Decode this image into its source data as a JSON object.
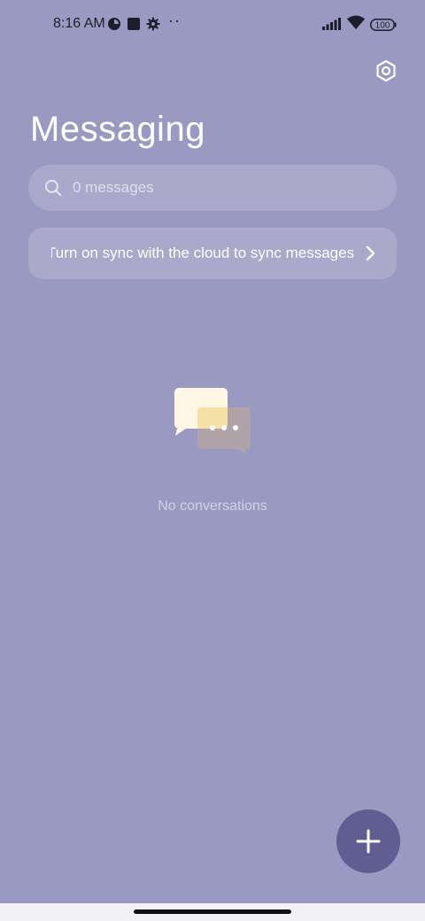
{
  "status_bar": {
    "time": "8:16 AM",
    "overflow_dots": "··",
    "battery": "100",
    "icons": [
      "data-saver-icon",
      "square-app-icon",
      "gear-icon",
      "signal-icon",
      "wifi-icon",
      "battery-icon"
    ]
  },
  "header": {
    "title": "Messaging",
    "settings_icon": "hexagon-settings-icon"
  },
  "search": {
    "placeholder": "0 messages",
    "icon": "search-icon"
  },
  "sync_banner": {
    "text": "Turn on sync with the cloud to sync messages",
    "icon": "chevron-right-icon"
  },
  "empty_state": {
    "text": "No conversations",
    "icon": "chat-bubbles-icon"
  },
  "fab": {
    "icon": "plus-icon"
  },
  "colors": {
    "background": "#9a99c1",
    "fab": "#5f5d92",
    "surface": "rgba(255,255,255,0.16)"
  }
}
